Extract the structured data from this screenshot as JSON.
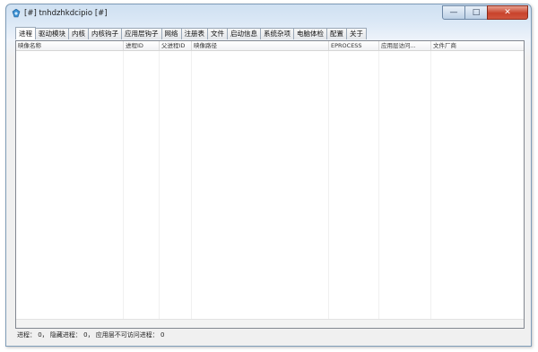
{
  "window": {
    "title": "[#] tnhdzhkdcipio [#]"
  },
  "tabs": [
    {
      "label": "进程",
      "active": true
    },
    {
      "label": "驱动模块",
      "active": false
    },
    {
      "label": "内核",
      "active": false
    },
    {
      "label": "内核钩子",
      "active": false
    },
    {
      "label": "应用层钩子",
      "active": false
    },
    {
      "label": "网络",
      "active": false
    },
    {
      "label": "注册表",
      "active": false
    },
    {
      "label": "文件",
      "active": false
    },
    {
      "label": "启动信息",
      "active": false
    },
    {
      "label": "系统杂项",
      "active": false
    },
    {
      "label": "电脑体检",
      "active": false
    },
    {
      "label": "配置",
      "active": false
    },
    {
      "label": "关于",
      "active": false
    }
  ],
  "table": {
    "columns": [
      "映像名称",
      "进程ID",
      "父进程ID",
      "映像路径",
      "EPROCESS",
      "应用层访问...",
      "文件厂商"
    ]
  },
  "status": {
    "text": "进程： 0， 隐藏进程： 0， 应用层不可访问进程： 0"
  }
}
